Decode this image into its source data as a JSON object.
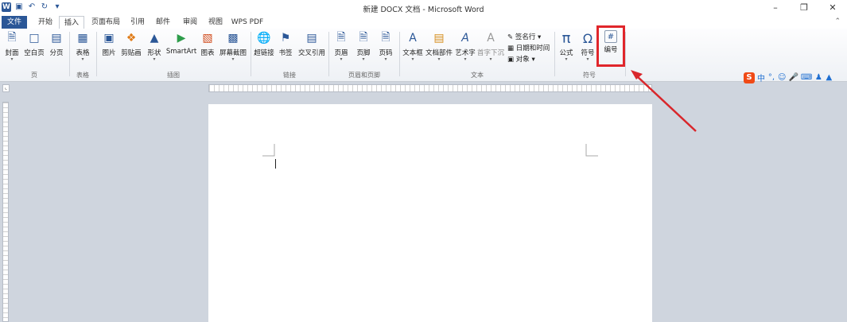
{
  "window": {
    "title": "新建 DOCX 文档 - Microsoft Word",
    "controls": [
      "minimize-icon",
      "restore-icon",
      "close-icon"
    ]
  },
  "quick_access": [
    "word-logo-icon",
    "save-icon",
    "undo-icon",
    "redo-icon",
    "customize-icon"
  ],
  "tabs": [
    {
      "label": "文件"
    },
    {
      "label": "开始"
    },
    {
      "label": "插入"
    },
    {
      "label": "页面布局"
    },
    {
      "label": "引用"
    },
    {
      "label": "邮件"
    },
    {
      "label": "审阅"
    },
    {
      "label": "视图"
    },
    {
      "label": "WPS PDF"
    }
  ],
  "ribbon": {
    "pages": {
      "cover": "封面",
      "blank": "空白页",
      "break": "分页",
      "group": "页"
    },
    "tables": {
      "table": "表格",
      "group": "表格"
    },
    "illustrations": {
      "picture": "图片",
      "clipart": "剪贴画",
      "shapes": "形状",
      "smartart": "SmartArt",
      "chart": "图表",
      "screenshot": "屏幕截图",
      "group": "插图"
    },
    "links": {
      "hyperlink": "超链接",
      "bookmark": "书签",
      "crossref": "交叉引用",
      "group": "链接"
    },
    "header_footer": {
      "header": "页眉",
      "footer": "页脚",
      "page_number": "页码",
      "group": "页眉和页脚"
    },
    "text": {
      "textbox": "文本框",
      "quickparts": "文档部件",
      "wordart": "艺术字",
      "dropcap": "首字下沉",
      "signature": "签名行",
      "datetime": "日期和时间",
      "object": "对象",
      "group": "文本"
    },
    "symbols": {
      "equation": "公式",
      "symbol": "符号",
      "number": "编号",
      "group": "符号"
    }
  },
  "ime_toolbar": {
    "mode": "中",
    "punct": "°,",
    "icons": [
      "sogou-logo-icon",
      "emoji-icon",
      "microphone-icon",
      "keyboard-icon",
      "user-icon",
      "shirt-icon"
    ]
  },
  "colors": {
    "accent": "#2b5797",
    "highlight": "#e0262b",
    "background": "#cfd5de"
  }
}
